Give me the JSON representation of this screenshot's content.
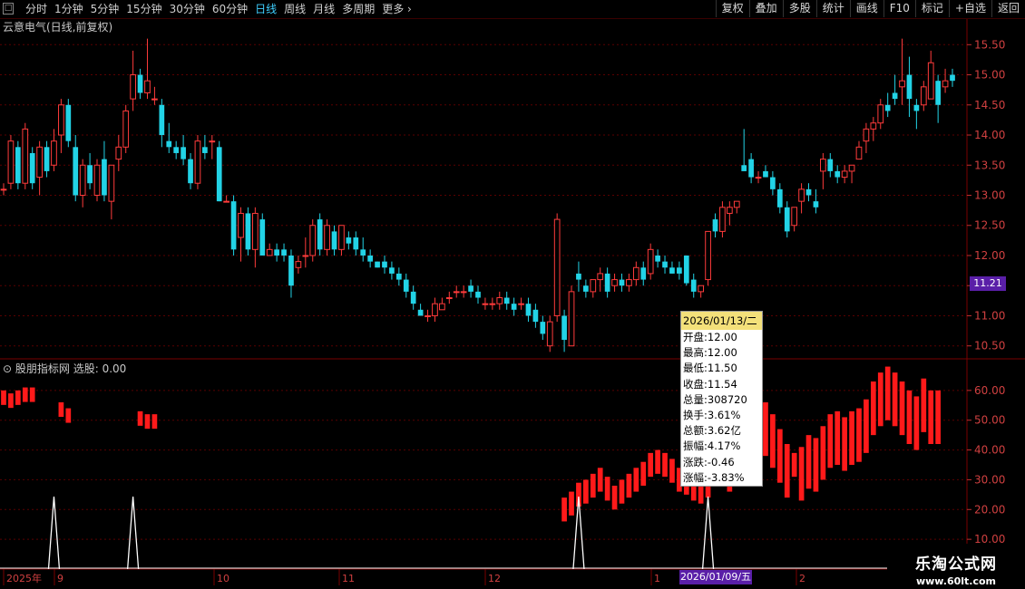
{
  "toolbar": {
    "back_icon": "back-icon",
    "timeframes": [
      "分时",
      "1分钟",
      "5分钟",
      "15分钟",
      "30分钟",
      "60分钟",
      "日线",
      "周线",
      "月线",
      "多周期",
      "更多"
    ],
    "active_timeframe": "日线",
    "more_icon": "chevron-right-icon",
    "tools": [
      "复权",
      "叠加",
      "多股",
      "统计",
      "画线",
      "F10",
      "标记",
      "+自选",
      "返回"
    ]
  },
  "chart_title": "云意电气(日线,前复权)",
  "indicator_title": "股朋指标网  选股: 0.00",
  "price_axis": {
    "ticks": [
      "15.50",
      "15.00",
      "14.50",
      "14.00",
      "13.50",
      "13.00",
      "12.50",
      "12.00",
      "11.50",
      "11.00",
      "10.50"
    ]
  },
  "current_price": "11.21",
  "indicator_axis": {
    "ticks": [
      "60.00",
      "50.00",
      "40.00",
      "30.00",
      "20.00",
      "10.00"
    ]
  },
  "time_axis": {
    "labels": [
      "2025年",
      "9",
      "10",
      "11",
      "12",
      "1",
      "2"
    ],
    "cursor_date": "2026/01/09/五"
  },
  "tooltip": {
    "date": "2026/01/13/二",
    "rows": [
      "开盘:12.00",
      "最高:12.00",
      "最低:11.50",
      "收盘:11.54",
      "总量:308720",
      "换手:3.61%",
      "总额:3.62亿",
      "振幅:4.17%",
      "涨跌:-0.46",
      "涨幅:-3.83%"
    ]
  },
  "watermark": {
    "name": "乐淘公式网",
    "url": "www.60lt.com"
  },
  "colors": {
    "up": "#ff3b3b",
    "down": "#22d3e6",
    "bar": "#ff1a1a",
    "grid": "#5a0000",
    "accent": "#3fd0ff",
    "tag": "#5a1fa8"
  },
  "chart_data": {
    "type": "candlestick",
    "title": "云意电气(日线,前复权)",
    "ylim": [
      10.3,
      15.7
    ],
    "candles": [
      [
        13.1,
        13.2,
        13.0,
        13.1
      ],
      [
        13.2,
        14.0,
        13.1,
        13.9
      ],
      [
        13.8,
        13.9,
        13.1,
        13.2
      ],
      [
        13.2,
        14.2,
        13.1,
        14.1
      ],
      [
        13.7,
        13.8,
        13.1,
        13.2
      ],
      [
        13.3,
        13.9,
        13.0,
        13.8
      ],
      [
        13.8,
        13.9,
        13.3,
        13.4
      ],
      [
        13.5,
        14.1,
        13.4,
        13.9
      ],
      [
        14.0,
        14.6,
        13.7,
        14.5
      ],
      [
        14.5,
        14.6,
        13.8,
        13.9
      ],
      [
        13.8,
        14.0,
        12.9,
        13.0
      ],
      [
        13.0,
        13.6,
        12.8,
        13.5
      ],
      [
        13.5,
        13.7,
        13.1,
        13.2
      ],
      [
        13.0,
        13.6,
        12.9,
        13.5
      ],
      [
        13.6,
        13.9,
        12.9,
        13.0
      ],
      [
        12.9,
        13.5,
        12.6,
        13.5
      ],
      [
        13.6,
        14.0,
        13.4,
        13.8
      ],
      [
        13.8,
        14.5,
        13.7,
        14.4
      ],
      [
        14.6,
        15.4,
        14.4,
        15.0
      ],
      [
        15.0,
        15.1,
        14.6,
        14.7
      ],
      [
        14.7,
        15.6,
        14.6,
        14.9
      ],
      [
        14.6,
        14.8,
        14.5,
        14.6
      ],
      [
        14.5,
        14.6,
        13.8,
        14.0
      ],
      [
        13.9,
        14.2,
        13.7,
        13.8
      ],
      [
        13.8,
        13.9,
        13.6,
        13.7
      ],
      [
        13.8,
        14.0,
        13.5,
        13.6
      ],
      [
        13.6,
        13.7,
        13.1,
        13.2
      ],
      [
        13.2,
        14.0,
        13.1,
        13.9
      ],
      [
        13.8,
        14.0,
        13.6,
        13.7
      ],
      [
        13.9,
        14.0,
        13.6,
        13.9
      ],
      [
        13.8,
        13.9,
        12.9,
        12.9
      ],
      [
        12.9,
        13.0,
        12.9,
        12.9
      ],
      [
        12.9,
        13.0,
        12.0,
        12.1
      ],
      [
        12.3,
        12.8,
        11.9,
        12.7
      ],
      [
        12.7,
        12.8,
        12.0,
        12.1
      ],
      [
        12.1,
        12.8,
        11.8,
        12.7
      ],
      [
        12.6,
        12.7,
        12.0,
        12.0
      ],
      [
        12.0,
        12.2,
        12.0,
        12.1
      ],
      [
        12.1,
        12.2,
        11.9,
        12.0
      ],
      [
        12.1,
        12.2,
        11.9,
        12.0
      ],
      [
        12.0,
        12.1,
        11.3,
        11.5
      ],
      [
        11.8,
        12.0,
        11.7,
        11.9
      ],
      [
        12.0,
        12.3,
        11.8,
        12.0
      ],
      [
        12.0,
        12.6,
        11.9,
        12.5
      ],
      [
        12.6,
        12.7,
        12.0,
        12.1
      ],
      [
        12.1,
        12.6,
        12.0,
        12.5
      ],
      [
        12.4,
        12.5,
        12.0,
        12.1
      ],
      [
        12.1,
        12.5,
        12.0,
        12.5
      ],
      [
        12.3,
        12.4,
        12.1,
        12.2
      ],
      [
        12.3,
        12.4,
        12.0,
        12.1
      ],
      [
        12.1,
        12.3,
        11.9,
        12.0
      ],
      [
        12.0,
        12.1,
        11.8,
        11.9
      ],
      [
        11.9,
        11.9,
        11.8,
        11.8
      ],
      [
        11.9,
        12.0,
        11.7,
        11.8
      ],
      [
        11.8,
        11.9,
        11.6,
        11.7
      ],
      [
        11.7,
        11.8,
        11.5,
        11.6
      ],
      [
        11.6,
        11.7,
        11.3,
        11.4
      ],
      [
        11.4,
        11.5,
        11.1,
        11.2
      ],
      [
        11.1,
        11.2,
        11.0,
        11.0
      ],
      [
        11.0,
        11.1,
        10.9,
        11.0
      ],
      [
        11.0,
        11.3,
        10.9,
        11.2
      ],
      [
        11.1,
        11.3,
        11.1,
        11.2
      ],
      [
        11.3,
        11.4,
        11.2,
        11.3
      ],
      [
        11.4,
        11.5,
        11.3,
        11.4
      ],
      [
        11.4,
        11.5,
        11.3,
        11.4
      ],
      [
        11.5,
        11.6,
        11.3,
        11.4
      ],
      [
        11.4,
        11.5,
        11.2,
        11.3
      ],
      [
        11.2,
        11.3,
        11.1,
        11.2
      ],
      [
        11.2,
        11.3,
        11.1,
        11.2
      ],
      [
        11.2,
        11.4,
        11.1,
        11.3
      ],
      [
        11.3,
        11.4,
        11.1,
        11.2
      ],
      [
        11.2,
        11.3,
        11.0,
        11.1
      ],
      [
        11.2,
        11.3,
        11.1,
        11.2
      ],
      [
        11.2,
        11.3,
        10.9,
        11.0
      ],
      [
        11.1,
        11.2,
        10.8,
        10.9
      ],
      [
        10.9,
        11.0,
        10.6,
        10.7
      ],
      [
        10.5,
        11.0,
        10.4,
        10.9
      ],
      [
        11.0,
        12.7,
        10.9,
        12.6
      ],
      [
        11.0,
        11.1,
        10.4,
        10.6
      ],
      [
        10.5,
        11.5,
        10.5,
        11.4
      ],
      [
        11.7,
        11.9,
        11.4,
        11.6
      ],
      [
        11.5,
        11.6,
        11.3,
        11.4
      ],
      [
        11.4,
        11.6,
        11.3,
        11.6
      ],
      [
        11.6,
        11.8,
        11.4,
        11.7
      ],
      [
        11.7,
        11.8,
        11.3,
        11.4
      ],
      [
        11.5,
        11.7,
        11.4,
        11.6
      ],
      [
        11.6,
        11.7,
        11.4,
        11.5
      ],
      [
        11.5,
        11.7,
        11.4,
        11.6
      ],
      [
        11.6,
        11.9,
        11.5,
        11.8
      ],
      [
        11.8,
        11.9,
        11.5,
        11.6
      ],
      [
        11.7,
        12.2,
        11.6,
        12.1
      ],
      [
        12.0,
        12.1,
        11.8,
        11.9
      ],
      [
        11.9,
        12.0,
        11.7,
        11.8
      ],
      [
        11.8,
        11.9,
        11.7,
        11.7
      ],
      [
        11.8,
        11.9,
        11.6,
        11.7
      ],
      [
        12.0,
        12.0,
        11.5,
        11.54
      ],
      [
        11.6,
        11.7,
        11.3,
        11.4
      ],
      [
        11.4,
        11.5,
        11.3,
        11.5
      ],
      [
        11.6,
        12.4,
        11.5,
        12.4
      ],
      [
        12.6,
        12.7,
        12.3,
        12.4
      ],
      [
        12.4,
        12.9,
        12.3,
        12.8
      ],
      [
        12.7,
        12.9,
        12.5,
        12.8
      ],
      [
        12.8,
        12.9,
        12.7,
        12.9
      ],
      [
        13.5,
        14.1,
        13.4,
        13.4
      ],
      [
        13.6,
        13.7,
        13.2,
        13.3
      ],
      [
        13.3,
        13.4,
        13.2,
        13.3
      ],
      [
        13.4,
        13.5,
        13.3,
        13.3
      ],
      [
        13.3,
        13.4,
        13.0,
        13.1
      ],
      [
        13.1,
        13.2,
        12.7,
        12.8
      ],
      [
        12.8,
        12.9,
        12.3,
        12.4
      ],
      [
        12.5,
        12.8,
        12.4,
        12.8
      ],
      [
        12.9,
        13.2,
        12.7,
        13.1
      ],
      [
        13.1,
        13.2,
        12.9,
        13.0
      ],
      [
        12.9,
        13.1,
        12.7,
        12.8
      ],
      [
        13.4,
        13.7,
        13.1,
        13.6
      ],
      [
        13.6,
        13.7,
        13.3,
        13.4
      ],
      [
        13.4,
        13.5,
        13.2,
        13.3
      ],
      [
        13.3,
        13.5,
        13.2,
        13.4
      ],
      [
        13.4,
        13.5,
        13.2,
        13.5
      ],
      [
        13.6,
        13.9,
        13.6,
        13.8
      ],
      [
        13.9,
        14.2,
        13.7,
        14.1
      ],
      [
        14.1,
        14.3,
        13.9,
        14.2
      ],
      [
        14.2,
        14.6,
        14.1,
        14.5
      ],
      [
        14.5,
        14.7,
        14.3,
        14.4
      ],
      [
        14.7,
        15.0,
        14.5,
        14.6
      ],
      [
        14.8,
        15.6,
        14.5,
        14.9
      ],
      [
        15.0,
        15.3,
        14.3,
        14.6
      ],
      [
        14.5,
        14.6,
        14.1,
        14.4
      ],
      [
        14.5,
        14.9,
        14.4,
        14.8
      ],
      [
        14.6,
        15.4,
        14.6,
        15.2
      ],
      [
        14.9,
        15.0,
        14.2,
        14.5
      ],
      [
        14.8,
        15.1,
        14.7,
        14.9
      ],
      [
        15.0,
        15.1,
        14.8,
        14.9
      ]
    ],
    "indicator_bars": [
      {
        "i": 0,
        "v": 60
      },
      {
        "i": 1,
        "v": 59
      },
      {
        "i": 2,
        "v": 60
      },
      {
        "i": 3,
        "v": 61
      },
      {
        "i": 4,
        "v": 61
      },
      {
        "i": 8,
        "v": 56
      },
      {
        "i": 9,
        "v": 54
      },
      {
        "i": 19,
        "v": 53
      },
      {
        "i": 20,
        "v": 52
      },
      {
        "i": 21,
        "v": 52
      },
      {
        "i": 78,
        "v": 24
      },
      {
        "i": 79,
        "v": 26
      },
      {
        "i": 80,
        "v": 29
      },
      {
        "i": 81,
        "v": 30
      },
      {
        "i": 82,
        "v": 32
      },
      {
        "i": 83,
        "v": 34
      },
      {
        "i": 84,
        "v": 31
      },
      {
        "i": 85,
        "v": 28
      },
      {
        "i": 86,
        "v": 30
      },
      {
        "i": 87,
        "v": 32
      },
      {
        "i": 88,
        "v": 34
      },
      {
        "i": 89,
        "v": 36
      },
      {
        "i": 90,
        "v": 39
      },
      {
        "i": 91,
        "v": 40
      },
      {
        "i": 92,
        "v": 39
      },
      {
        "i": 93,
        "v": 37
      },
      {
        "i": 94,
        "v": 34
      },
      {
        "i": 95,
        "v": 33
      },
      {
        "i": 96,
        "v": 31
      },
      {
        "i": 97,
        "v": 30
      },
      {
        "i": 98,
        "v": 32
      },
      {
        "i": 99,
        "v": 36
      },
      {
        "i": 100,
        "v": 40
      },
      {
        "i": 101,
        "v": 44
      },
      {
        "i": 102,
        "v": 50
      },
      {
        "i": 103,
        "v": 59
      },
      {
        "i": 104,
        "v": 62
      },
      {
        "i": 105,
        "v": 58
      },
      {
        "i": 106,
        "v": 56
      },
      {
        "i": 107,
        "v": 52
      },
      {
        "i": 108,
        "v": 47
      },
      {
        "i": 109,
        "v": 42
      },
      {
        "i": 110,
        "v": 39
      },
      {
        "i": 111,
        "v": 41
      },
      {
        "i": 112,
        "v": 45
      },
      {
        "i": 113,
        "v": 44
      },
      {
        "i": 114,
        "v": 48
      },
      {
        "i": 115,
        "v": 52
      },
      {
        "i": 116,
        "v": 53
      },
      {
        "i": 117,
        "v": 51
      },
      {
        "i": 118,
        "v": 53
      },
      {
        "i": 119,
        "v": 54
      },
      {
        "i": 120,
        "v": 57
      },
      {
        "i": 121,
        "v": 63
      },
      {
        "i": 122,
        "v": 66
      },
      {
        "i": 123,
        "v": 68
      },
      {
        "i": 124,
        "v": 66
      },
      {
        "i": 125,
        "v": 63
      },
      {
        "i": 126,
        "v": 60
      },
      {
        "i": 127,
        "v": 58
      },
      {
        "i": 128,
        "v": 64
      },
      {
        "i": 129,
        "v": 60
      },
      {
        "i": 130,
        "v": 60
      }
    ],
    "signals": [
      7,
      18,
      80,
      98
    ]
  }
}
